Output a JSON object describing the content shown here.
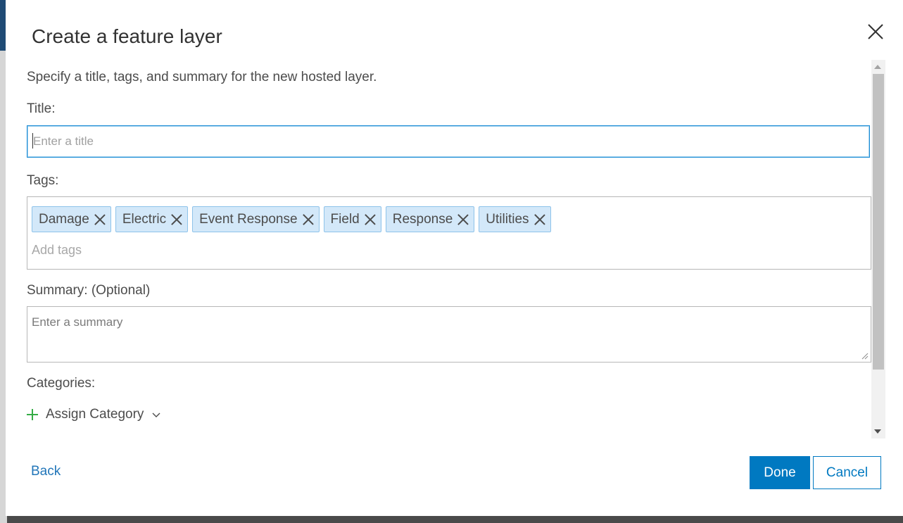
{
  "dialog": {
    "title": "Create a feature layer",
    "close_icon": "close-icon"
  },
  "form": {
    "intro": "Specify a title, tags, and summary for the new hosted layer.",
    "title_label": "Title:",
    "title_placeholder": "Enter a title",
    "title_value": "",
    "tags_label": "Tags:",
    "tags": [
      {
        "label": "Damage"
      },
      {
        "label": "Electric"
      },
      {
        "label": "Event Response"
      },
      {
        "label": "Field"
      },
      {
        "label": "Response"
      },
      {
        "label": "Utilities"
      }
    ],
    "tags_placeholder": "Add tags",
    "summary_label": "Summary: (Optional)",
    "summary_placeholder": "Enter a summary",
    "categories_label": "Categories:",
    "assign_category": "Assign Category"
  },
  "footer": {
    "back": "Back",
    "done": "Done",
    "cancel": "Cancel"
  },
  "colors": {
    "accent": "#0079c1",
    "tag_bg": "#d3e8f9",
    "plus_icon": "#35ac46"
  }
}
